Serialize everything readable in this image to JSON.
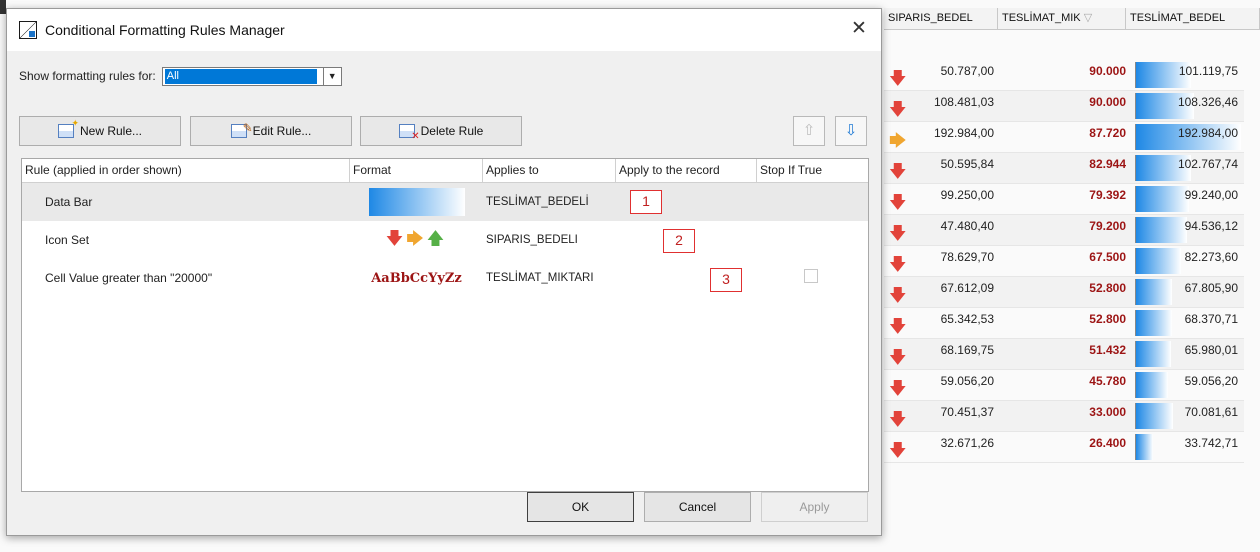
{
  "dialog": {
    "title": "Conditional Formatting Rules Manager",
    "close_glyph": "✕",
    "show_rules_label": "Show formatting rules for:",
    "show_rules_value": "All",
    "toolbar": {
      "new_rule": "New Rule...",
      "edit_rule": "Edit Rule...",
      "delete_rule": "Delete Rule",
      "move_up_glyph": "⇧",
      "move_down_glyph": "⇩"
    },
    "columns": [
      "Rule (applied in order shown)",
      "Format",
      "Applies to",
      "Apply to the record",
      "Stop If True"
    ],
    "rules": [
      {
        "rule": "Data Bar",
        "applies_to": "TESLİMAT_BEDELİ",
        "marker": "1"
      },
      {
        "rule": "Icon Set",
        "applies_to": "SIPARIS_BEDELI",
        "marker": "2",
        "icons": "🡇 🡆 🡅"
      },
      {
        "rule": "Cell Value greater than \"20000\"",
        "applies_to": "TESLİMAT_MIKTARI",
        "marker": "3",
        "format_text": "AaBbCcYyZz"
      }
    ],
    "buttons": {
      "ok": "OK",
      "cancel": "Cancel",
      "apply": "Apply"
    }
  },
  "grid": {
    "headers": [
      "SIPARIS_BEDEL",
      "TESLİMAT_MIK",
      "TESLİMAT_BEDEL"
    ],
    "sort_glyph": "▽",
    "colors": {
      "arrow_down": "#e2433a",
      "arrow_right": "#f0a630",
      "arrow_up": "#56b047",
      "bold_value": "#9c1414",
      "databar": "#1e88e5"
    },
    "rows": [
      {
        "icon": "down",
        "siparis": "50.787,00",
        "miktar": "90.000",
        "bedel": "101.119,75",
        "bar": 0.53
      },
      {
        "icon": "down",
        "siparis": "108.481,03",
        "miktar": "90.000",
        "bedel": "108.326,46",
        "bar": 0.56
      },
      {
        "icon": "right",
        "siparis": "192.984,00",
        "miktar": "87.720",
        "bedel": "192.984,00",
        "bar": 1.0
      },
      {
        "icon": "down",
        "siparis": "50.595,84",
        "miktar": "82.944",
        "bedel": "102.767,74",
        "bar": 0.53
      },
      {
        "icon": "down",
        "siparis": "99.250,00",
        "miktar": "79.392",
        "bedel": "99.240,00",
        "bar": 0.51
      },
      {
        "icon": "down",
        "siparis": "47.480,40",
        "miktar": "79.200",
        "bedel": "94.536,12",
        "bar": 0.49
      },
      {
        "icon": "down",
        "siparis": "78.629,70",
        "miktar": "67.500",
        "bedel": "82.273,60",
        "bar": 0.43
      },
      {
        "icon": "down",
        "siparis": "67.612,09",
        "miktar": "52.800",
        "bedel": "67.805,90",
        "bar": 0.35
      },
      {
        "icon": "down",
        "siparis": "65.342,53",
        "miktar": "52.800",
        "bedel": "68.370,71",
        "bar": 0.35
      },
      {
        "icon": "down",
        "siparis": "68.169,75",
        "miktar": "51.432",
        "bedel": "65.980,01",
        "bar": 0.34
      },
      {
        "icon": "down",
        "siparis": "59.056,20",
        "miktar": "45.780",
        "bedel": "59.056,20",
        "bar": 0.31
      },
      {
        "icon": "down",
        "siparis": "70.451,37",
        "miktar": "33.000",
        "bedel": "70.081,61",
        "bar": 0.36
      },
      {
        "icon": "down",
        "siparis": "32.671,26",
        "miktar": "26.400",
        "bedel": "33.742,71",
        "bar": 0.17
      }
    ]
  }
}
